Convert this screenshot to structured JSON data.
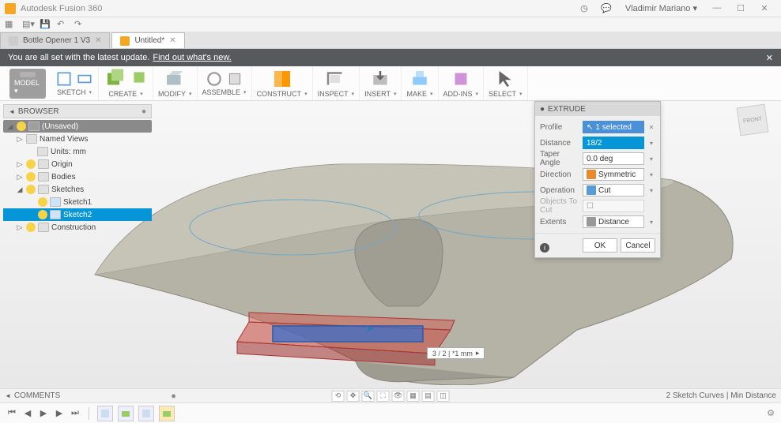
{
  "app": {
    "title": "Autodesk Fusion 360",
    "user": "Vladimir Mariano"
  },
  "tabs": [
    {
      "label": "Bottle Opener 1 V3",
      "active": false
    },
    {
      "label": "Untitled*",
      "active": true
    }
  ],
  "banner": {
    "text": "You are all set with the latest update.",
    "link": "Find out what's new."
  },
  "ribbon": {
    "model": "MODEL",
    "groups": [
      "SKETCH",
      "CREATE",
      "MODIFY",
      "ASSEMBLE",
      "CONSTRUCT",
      "INSPECT",
      "INSERT",
      "MAKE",
      "ADD-INS",
      "SELECT"
    ]
  },
  "browser": {
    "title": "BROWSER",
    "root": "(Unsaved)",
    "items": [
      {
        "label": "Named Views",
        "level": 1,
        "expandable": true
      },
      {
        "label": "Units: mm",
        "level": 2,
        "expandable": false
      },
      {
        "label": "Origin",
        "level": 1,
        "expandable": true,
        "bulb": true
      },
      {
        "label": "Bodies",
        "level": 1,
        "expandable": true,
        "bulb": true
      },
      {
        "label": "Sketches",
        "level": 1,
        "expandable": true,
        "expanded": true,
        "bulb": true
      },
      {
        "label": "Sketch1",
        "level": 2,
        "bulb": true,
        "sketch": true
      },
      {
        "label": "Sketch2",
        "level": 2,
        "bulb": true,
        "sketch": true,
        "selected": true
      },
      {
        "label": "Construction",
        "level": 1,
        "expandable": true,
        "bulb": true
      }
    ]
  },
  "dialog": {
    "title": "EXTRUDE",
    "rows": {
      "profile_lbl": "Profile",
      "profile_val": "1 selected",
      "distance_lbl": "Distance",
      "distance_val": "18/2",
      "taper_lbl": "Taper Angle",
      "taper_val": "0.0 deg",
      "direction_lbl": "Direction",
      "direction_val": "Symmetric",
      "operation_lbl": "Operation",
      "operation_val": "Cut",
      "objects_lbl": "Objects To Cut",
      "objects_val": "",
      "extents_lbl": "Extents",
      "extents_val": "Distance"
    },
    "ok": "OK",
    "cancel": "Cancel"
  },
  "dimension": "3 / 2 | *1 mm",
  "comments": "COMMENTS",
  "status": "2 Sketch Curves | Min Distance",
  "viewcube": {
    "face": "FRONT"
  }
}
